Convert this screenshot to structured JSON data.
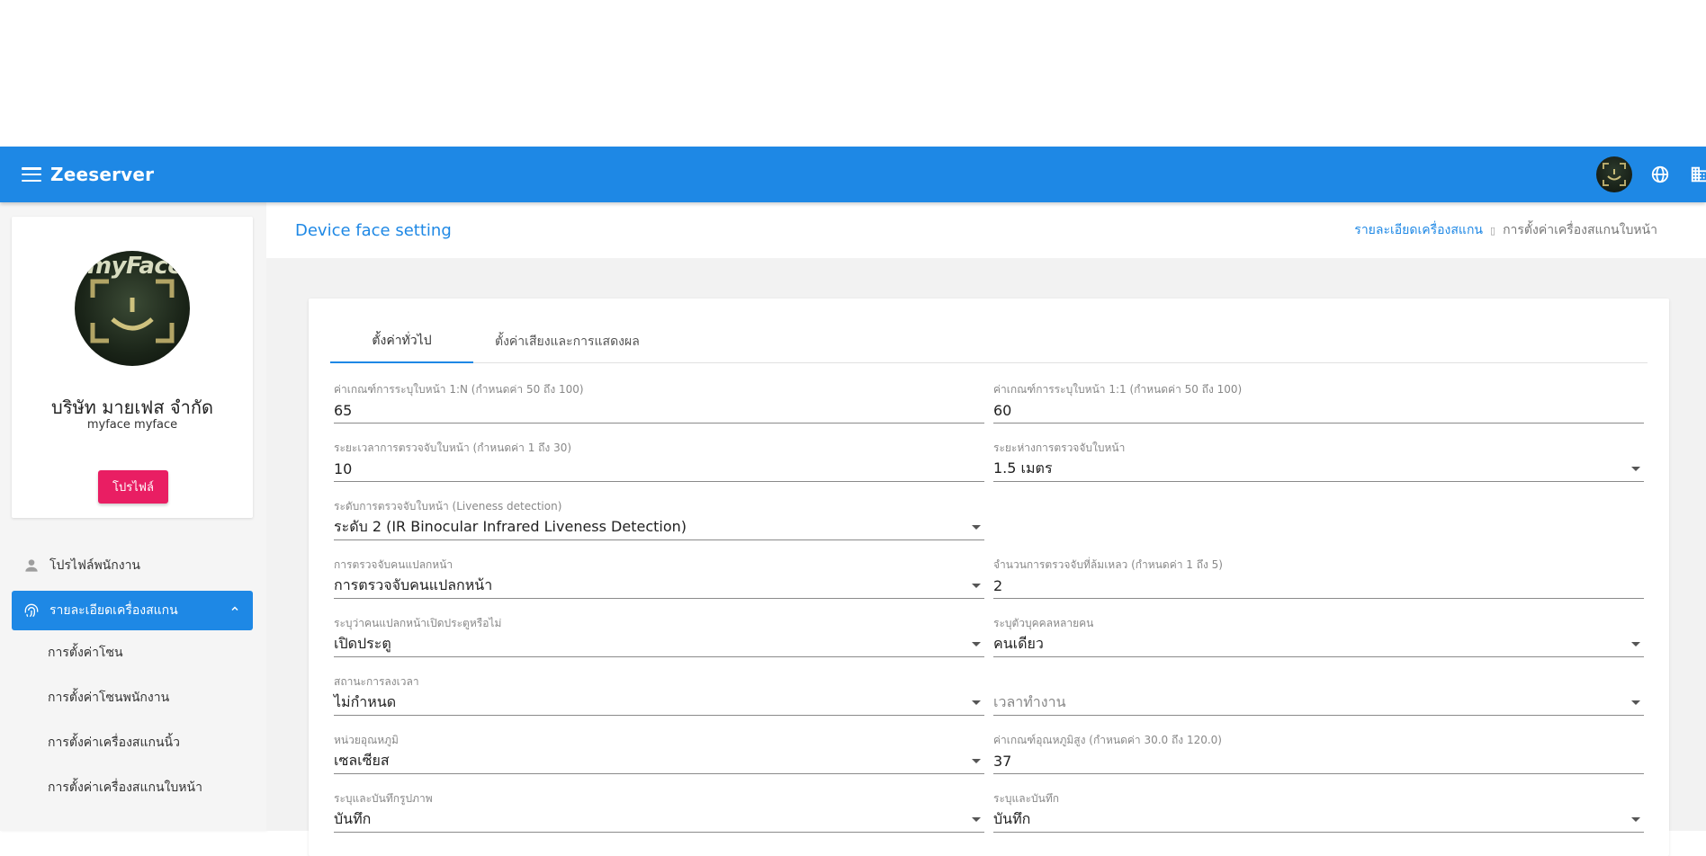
{
  "appbar": {
    "brand": "Zeeserver"
  },
  "profile": {
    "logo_text": "myFace",
    "company": "บริษัท มายเฟส จำกัด",
    "subtitle": "myface myface",
    "button": "โปรไฟล์"
  },
  "nav": {
    "employee_profile": "โปรไฟล์พนักงาน",
    "device_details": "รายละเอียดเครื่องสแกน",
    "sub": [
      "การตั้งค่าโซน",
      "การตั้งค่าโซนพนักงาน",
      "การตั้งค่าเครื่องสแกนนิ้ว",
      "การตั้งค่าเครื่องสแกนใบหน้า"
    ]
  },
  "page": {
    "title": "Device face setting",
    "breadcrumb_link": "รายละเอียดเครื่องสแกน",
    "breadcrumb_current": "การตั้งค่าเครื่องสแกนใบหน้า"
  },
  "tabs": [
    "ตั้งค่าทั่วไป",
    "ตั้งค่าเสียงและการแสดงผล"
  ],
  "fields": {
    "f1": {
      "label": "ค่าเกณฑ์การระบุใบหน้า 1:N (กำหนดค่า 50 ถึง 100)",
      "value": "65"
    },
    "f2": {
      "label": "ค่าเกณฑ์การระบุใบหน้า 1:1 (กำหนดค่า 50 ถึง 100)",
      "value": "60"
    },
    "f3": {
      "label": "ระยะเวลาการตรวจจับใบหน้า (กำหนดค่า 1 ถึง 30)",
      "value": "10"
    },
    "f4": {
      "label": "ระยะห่างการตรวจจับใบหน้า",
      "value": "1.5 เมตร"
    },
    "f5": {
      "label": "ระดับการตรวจจับใบหน้า (Liveness detection)",
      "value": "ระดับ 2 (IR Binocular Infrared Liveness Detection)"
    },
    "f6": {
      "label": "การตรวจจับคนแปลกหน้า",
      "value": "การตรวจจับคนแปลกหน้า"
    },
    "f7": {
      "label": "จำนวนการตรวจจับที่ล้มเหลว (กำหนดค่า 1 ถึง 5)",
      "value": "2"
    },
    "f8": {
      "label": "ระบุว่าคนแปลกหน้าเปิดประตูหรือไม่",
      "value": "เปิดประตู"
    },
    "f9": {
      "label": "ระบุตัวบุคคลหลายคน",
      "value": "คนเดียว"
    },
    "f10": {
      "label": "สถานะการลงเวลา",
      "value": "ไม่กำหนด"
    },
    "f11": {
      "label": "",
      "value": "เวลาทำงาน"
    },
    "f12": {
      "label": "หน่วยอุณหภูมิ",
      "value": "เซลเซียส"
    },
    "f13": {
      "label": "ค่าเกณฑ์อุณหภูมิสูง (กำหนดค่า 30.0 ถึง 120.0)",
      "value": "37"
    },
    "f14": {
      "label": "ระบุและบันทึกรูปภาพ",
      "value": "บันทึก"
    },
    "f15": {
      "label": "ระบุและบันทึก",
      "value": "บันทึก"
    }
  },
  "colors": {
    "primary": "#1e88e5",
    "accent": "#e91e63"
  },
  "icons": [
    "menu-icon",
    "globe-icon",
    "building-icon",
    "person-icon",
    "fingerprint-icon",
    "chevron-up-icon",
    "dropdown-caret-icon"
  ]
}
